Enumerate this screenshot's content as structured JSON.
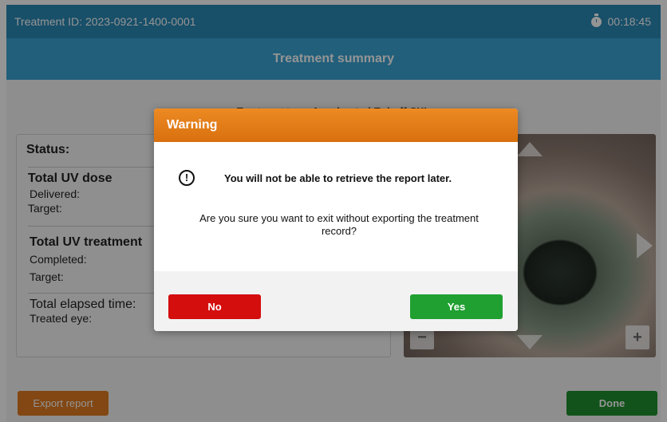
{
  "header": {
    "treatment_id": "Treatment ID: 2023-0921-1400-0001",
    "timer": "00:18:45",
    "timer_icon": "stopwatch-icon"
  },
  "title": "Treatment summary",
  "treatment_type": {
    "label": "Treatment type:",
    "value": "Accelerated Epi-off CXL"
  },
  "status_panel": {
    "title": "Status:",
    "uv_dose": {
      "heading": "Total UV dose",
      "delivered_label": "Delivered:",
      "target_label": "Target:"
    },
    "uv_treatment": {
      "heading": "Total UV treatment",
      "completed_label": "Completed:",
      "target_label": "Target:"
    },
    "elapsed_label": "Total elapsed time:",
    "treated_eye_label": "Treated eye:"
  },
  "eye_view": {
    "zoom_out": "−",
    "zoom_in": "+"
  },
  "bottom": {
    "export_label": "Export report",
    "done_label": "Done"
  },
  "dialog": {
    "title": "Warning",
    "icon_glyph": "!",
    "message_primary": "You will not be able to retrieve the report later.",
    "message_secondary": "Are you sure you want to exit without exporting the treatment record?",
    "no_label": "No",
    "yes_label": "Yes"
  },
  "colors": {
    "header_blue": "#2a89b6",
    "title_blue": "#3aa4d4",
    "warning_orange": "#e07a1f",
    "no_red": "#d40d0d",
    "yes_green": "#20a031"
  }
}
